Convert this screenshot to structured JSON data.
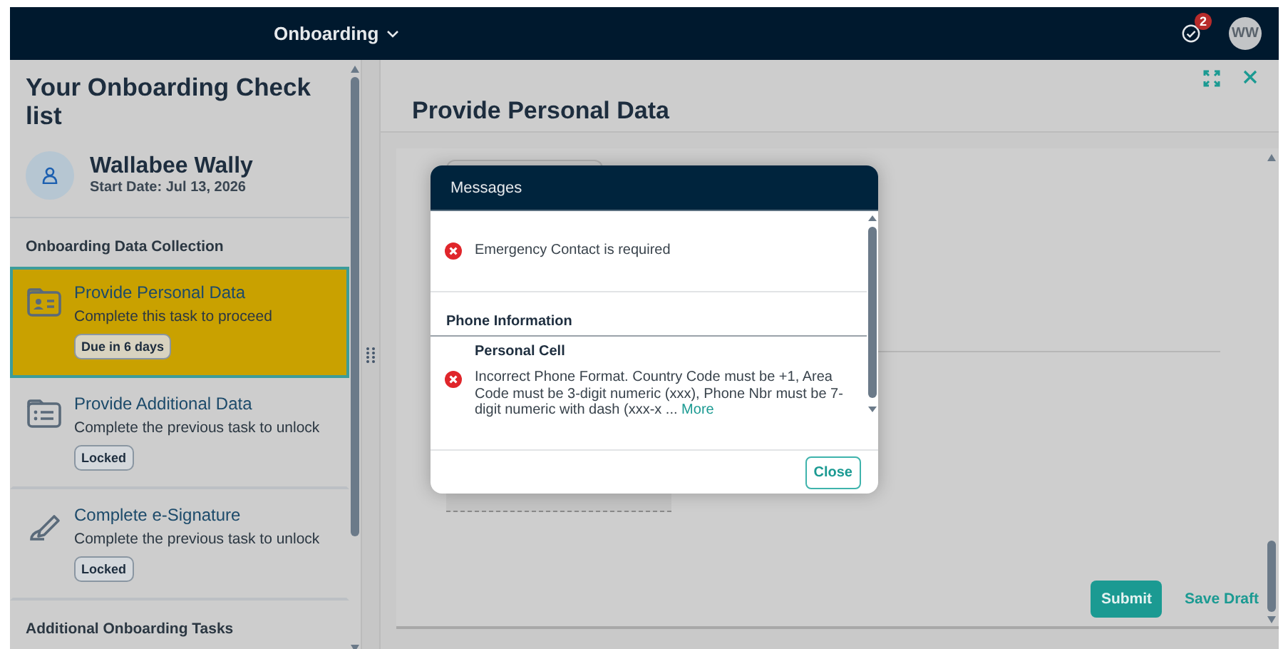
{
  "shell_bar": {
    "title": "Onboarding",
    "notification_count": "2",
    "avatar": "WW"
  },
  "checklist": {
    "title": "Your Onboarding Check list",
    "user": {
      "name": "Wallabee Wally",
      "start_date": "Start Date: Jul 13, 2026"
    },
    "sections": [
      {
        "title": "Onboarding Data Collection",
        "tasks": [
          {
            "kind": "personal",
            "title": "Provide Personal Data",
            "subtitle": "Complete this task to proceed",
            "badge": "Due in 6 days",
            "selected": true
          },
          {
            "kind": "additional",
            "title": "Provide Additional Data",
            "subtitle": "Complete the previous task to unlock",
            "badge": "Locked",
            "selected": false
          },
          {
            "kind": "signature",
            "title": "Complete e-Signature",
            "subtitle": "Complete the previous task to unlock",
            "badge": "Locked",
            "selected": false
          }
        ]
      },
      {
        "title": "Additional Onboarding Tasks"
      }
    ]
  },
  "detail": {
    "title": "Provide Personal Data",
    "actions": [
      {
        "kind": "primary",
        "label": "Submit"
      },
      {
        "kind": "link",
        "label": "Save Draft"
      }
    ]
  },
  "dialog": {
    "title": "Messages",
    "messages": [
      {
        "kind": "error",
        "text": "Emergency Contact is required"
      }
    ],
    "groups": [
      {
        "title": "Phone Information",
        "messages": [
          {
            "kind": "error",
            "subtitle": "Personal Cell",
            "text": "Incorrect Phone Format. Country Code must be +1, Area Code must be 3-digit numeric (xxx), Phone Nbr must be 7-digit numeric with dash (xxx-x ...",
            "link": "More"
          }
        ]
      }
    ],
    "button": "Close"
  }
}
